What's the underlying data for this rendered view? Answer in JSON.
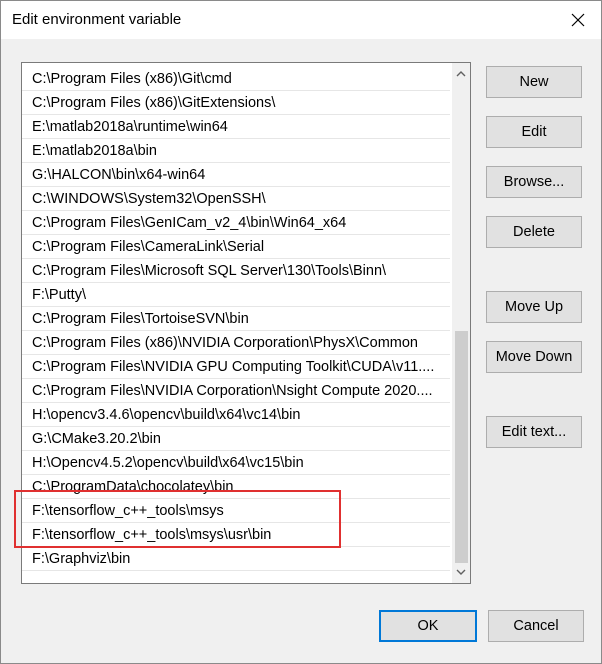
{
  "window": {
    "title": "Edit environment variable",
    "close_glyph": "✕"
  },
  "paths": [
    "C:\\Program Files (x86)\\Git\\cmd",
    "C:\\Program Files (x86)\\GitExtensions\\",
    "E:\\matlab2018a\\runtime\\win64",
    "E:\\matlab2018a\\bin",
    "G:\\HALCON\\bin\\x64-win64",
    "C:\\WINDOWS\\System32\\OpenSSH\\",
    "C:\\Program Files\\GenICam_v2_4\\bin\\Win64_x64",
    "C:\\Program Files\\CameraLink\\Serial",
    "C:\\Program Files\\Microsoft SQL Server\\130\\Tools\\Binn\\",
    "F:\\Putty\\",
    "C:\\Program Files\\TortoiseSVN\\bin",
    "C:\\Program Files (x86)\\NVIDIA Corporation\\PhysX\\Common",
    "C:\\Program Files\\NVIDIA GPU Computing Toolkit\\CUDA\\v11....",
    "C:\\Program Files\\NVIDIA Corporation\\Nsight Compute 2020....",
    "H:\\opencv3.4.6\\opencv\\build\\x64\\vc14\\bin",
    "G:\\CMake3.20.2\\bin",
    "H:\\Opencv4.5.2\\opencv\\build\\x64\\vc15\\bin",
    "C:\\ProgramData\\chocolatey\\bin",
    "F:\\tensorflow_c++_tools\\msys",
    "F:\\tensorflow_c++_tools\\msys\\usr\\bin",
    "F:\\Graphviz\\bin"
  ],
  "buttons": {
    "new": "New",
    "edit": "Edit",
    "browse": "Browse...",
    "delete": "Delete",
    "move_up": "Move Up",
    "move_down": "Move Down",
    "edit_text": "Edit text...",
    "ok": "OK",
    "cancel": "Cancel"
  },
  "icons": {
    "close": "close-icon",
    "scroll_up": "chevron-up-icon",
    "scroll_down": "chevron-down-icon"
  },
  "colors": {
    "highlight": "#e03030",
    "default_button_border": "#0078d7",
    "scroll_thumb": "#cdcdcd"
  }
}
